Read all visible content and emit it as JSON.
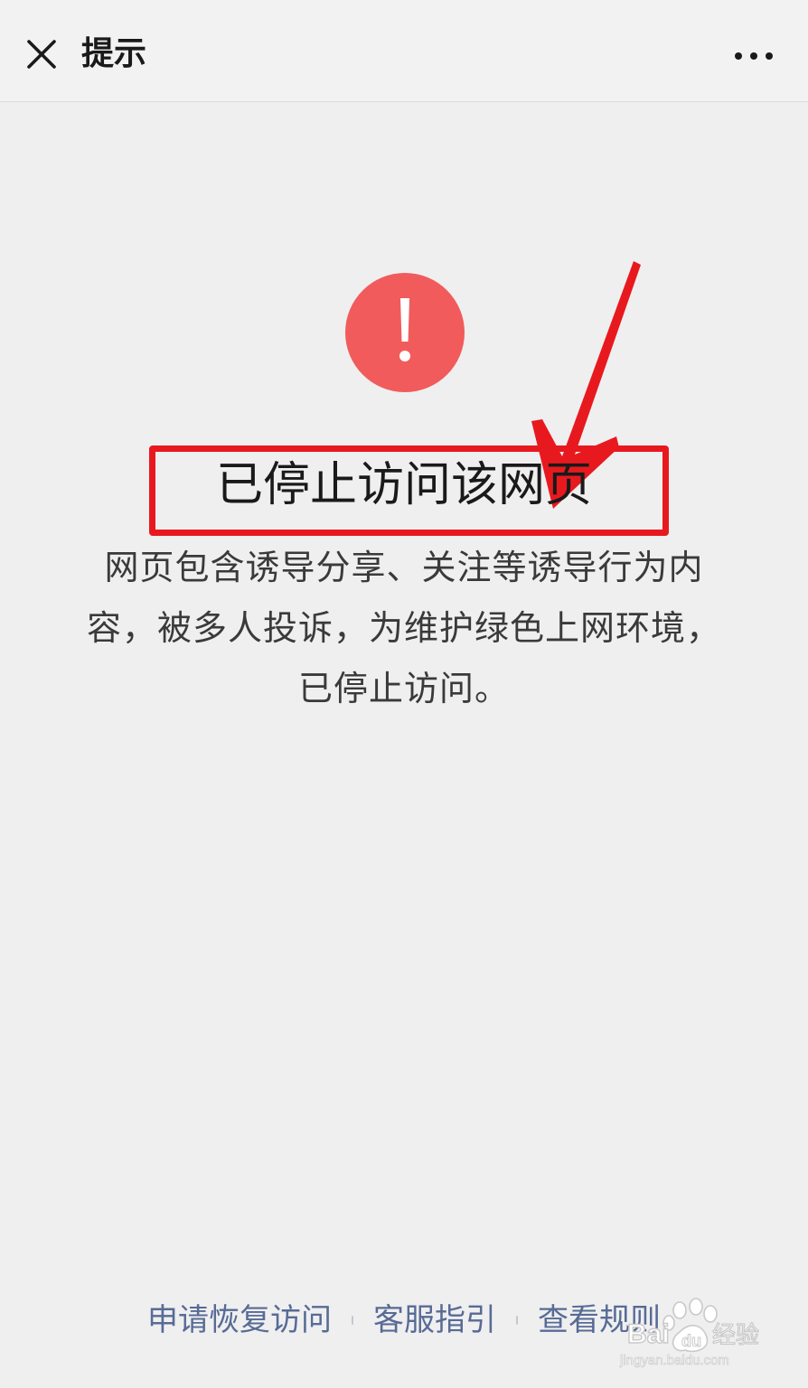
{
  "nav": {
    "title": "提示",
    "close_icon": "close-icon",
    "more_icon": "more-icon"
  },
  "message": {
    "icon": "exclamation-circle-icon",
    "icon_color": "#f25b5b",
    "title": "已停止访问该网页",
    "description": "网页包含诱导分享、关注等诱导行为内容，被多人投诉，为维护绿色上网环境，已停止访问。"
  },
  "annotation": {
    "color": "#e8191e"
  },
  "footer": {
    "links": [
      "申请恢复访问",
      "客服指引",
      "查看规则"
    ],
    "link_color": "#576b95"
  },
  "watermark": {
    "text": "经验",
    "subtext": "jingyan.baidu.com"
  }
}
